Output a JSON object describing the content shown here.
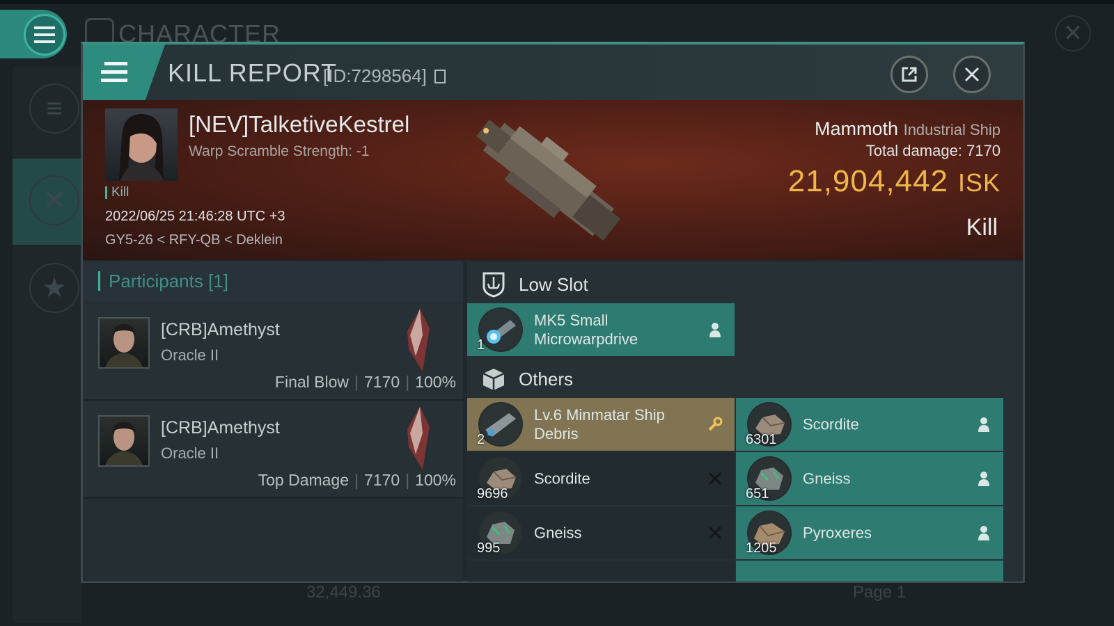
{
  "background": {
    "title": "CHARACTER",
    "wallet": "32,449.36",
    "page": "Page 1"
  },
  "header": {
    "title": "KILL REPORT",
    "report_id": "[ID:7298564]"
  },
  "victim": {
    "name": "[NEV]TalketiveKestrel",
    "warp_scramble": "Warp Scramble Strength: -1",
    "tag": "Kill",
    "datetime": "2022/06/25 21:46:28 UTC +3",
    "location": "GY5-26 < RFY-QB < Deklein",
    "ship": "Mammoth",
    "ship_class": "Industrial Ship",
    "total_damage_label": "Total damage:",
    "total_damage": "7170",
    "isk_value": "21,904,442",
    "isk_unit": "ISK",
    "kill_type": "Kill"
  },
  "participants": {
    "title": "Participants [1]",
    "rows": [
      {
        "name": "[CRB]Amethyst",
        "ship": "Oracle II",
        "role": "Final Blow",
        "damage": "7170",
        "percent": "100%"
      },
      {
        "name": "[CRB]Amethyst",
        "ship": "Oracle II",
        "role": "Top Damage",
        "damage": "7170",
        "percent": "100%"
      }
    ]
  },
  "modules": {
    "low_slot_label": "Low Slot",
    "others_label": "Others",
    "low_slot": [
      {
        "name": "MK5 Small Microwarpdrive",
        "qty": "1",
        "status": "dropped",
        "color": "#2e7b72"
      }
    ],
    "others": [
      {
        "name": "Lv.6 Minmatar Ship Debris",
        "qty": "2",
        "status": "special",
        "color": "#807452"
      },
      {
        "name": "Scordite",
        "qty": "6301",
        "status": "dropped",
        "color": "#2e7b72"
      },
      {
        "name": "Scordite",
        "qty": "9696",
        "status": "destroyed",
        "color": "#222b2f"
      },
      {
        "name": "Gneiss",
        "qty": "651",
        "status": "dropped",
        "color": "#2e7b72"
      },
      {
        "name": "Gneiss",
        "qty": "995",
        "status": "destroyed",
        "color": "#222b2f"
      },
      {
        "name": "Pyroxeres",
        "qty": "1205",
        "status": "dropped",
        "color": "#2e7b72"
      }
    ]
  },
  "colors": {
    "accent": "#3fb3a2",
    "isk": "#f0b64a",
    "dropped": "#2e7b72",
    "destroyed": "#222b2f",
    "special": "#807452"
  },
  "icons": [
    "menu-icon",
    "export-icon",
    "close-icon",
    "copy-icon",
    "low-slot-icon",
    "cargo-box-icon",
    "person-icon",
    "wrench-icon",
    "x-icon"
  ]
}
